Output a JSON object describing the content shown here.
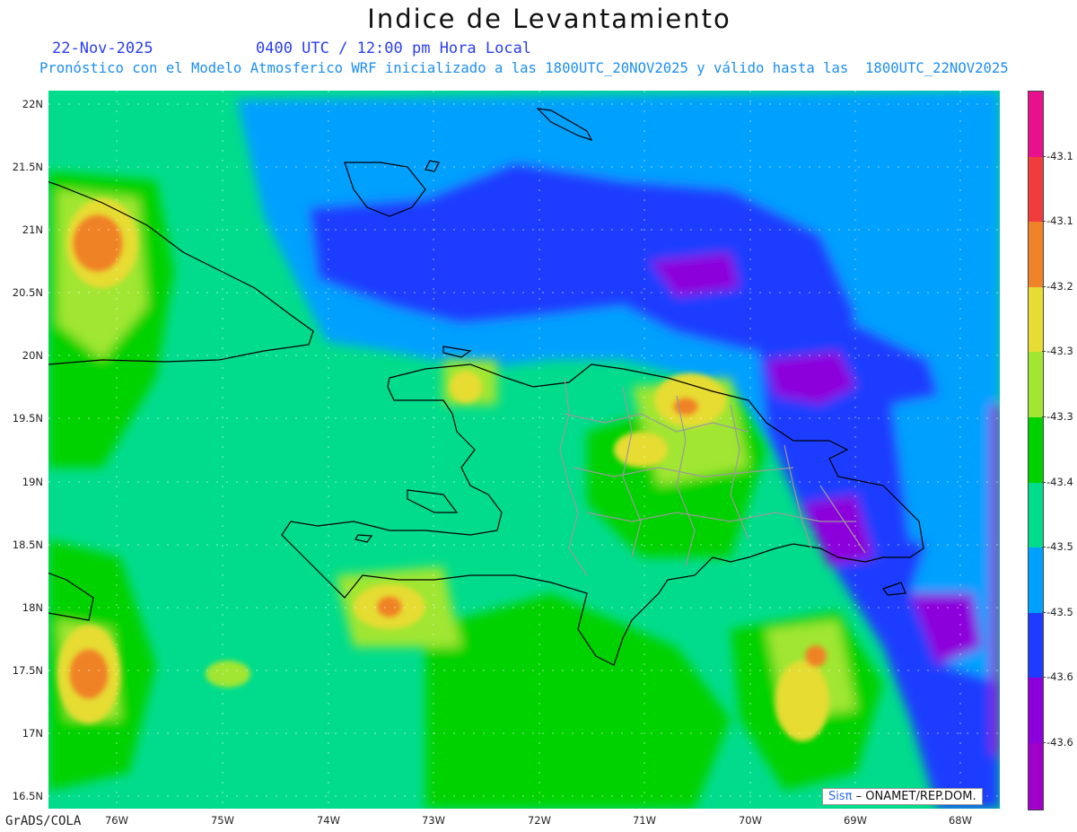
{
  "header": {
    "title": "Indice de Levantamiento",
    "date": "22-Nov-2025",
    "time": "0400 UTC / 12:00 pm Hora Local",
    "description": "Pronóstico con el Modelo Atmosferico WRF inicializado a las 1800UTC_20NOV2025 y válido hasta las  1800UTC_22NOV2025"
  },
  "axes": {
    "lat_labels": [
      "22N",
      "21.5N",
      "21N",
      "20.5N",
      "20N",
      "19.5N",
      "19N",
      "18.5N",
      "18N",
      "17.5N",
      "17N",
      "16.5N"
    ],
    "lon_labels": [
      "76W",
      "75W",
      "74W",
      "73W",
      "72W",
      "71W",
      "70W",
      "69W",
      "68W"
    ]
  },
  "colorbar": {
    "labels": [
      "-43.1",
      "-43.1",
      "-43.2",
      "-43.3",
      "-43.3",
      "-43.4",
      "-43.5",
      "-43.5",
      "-43.6",
      "-43.6"
    ],
    "colors": [
      "#e8108c",
      "#f03c3c",
      "#f08228",
      "#e6dc32",
      "#a0e632",
      "#00d200",
      "#00dc8c",
      "#00a0ff",
      "#1e3cff",
      "#8c00dc",
      "#a000c8"
    ]
  },
  "footer": {
    "software": "GrADS/COLA",
    "credit_brand": "Sisπ",
    "credit_rest": " – ONAMET/REP.DOM."
  }
}
